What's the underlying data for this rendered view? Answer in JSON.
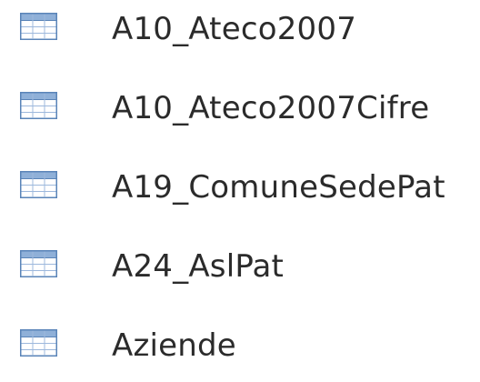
{
  "navigation_pane": {
    "items": [
      {
        "label": "A10_Ateco2007",
        "icon": "table-icon"
      },
      {
        "label": "A10_Ateco2007Cifre",
        "icon": "table-icon"
      },
      {
        "label": "A19_ComuneSedePat",
        "icon": "table-icon"
      },
      {
        "label": "A24_AslPat",
        "icon": "table-icon"
      },
      {
        "label": "Aziende",
        "icon": "table-icon"
      }
    ]
  },
  "colors": {
    "icon_border": "#5a84b8",
    "icon_header": "#8fb0d8",
    "icon_cell": "#ffffff",
    "icon_grid": "#9db8dc",
    "text": "#2b2b2b"
  }
}
